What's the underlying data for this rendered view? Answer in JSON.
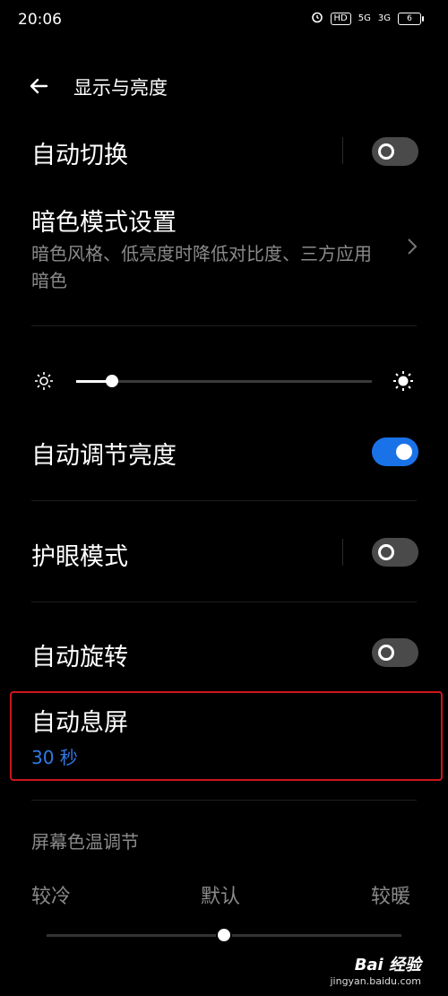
{
  "status_bar": {
    "time": "20:06",
    "hd_label": "HD",
    "signal1": "5G",
    "signal2": "3G",
    "battery": "6"
  },
  "header": {
    "back_icon": "arrow-left-icon",
    "title": "显示与亮度"
  },
  "items": {
    "auto_switch": {
      "label": "自动切换",
      "toggle_on": false
    },
    "dark_mode": {
      "label": "暗色模式设置",
      "description": "暗色风格、低亮度时降低对比度、三方应用暗色"
    },
    "brightness": {
      "level": 0.12
    },
    "auto_brightness": {
      "label": "自动调节亮度",
      "toggle_on": true
    },
    "eye_care": {
      "label": "护眼模式",
      "toggle_on": false
    },
    "auto_rotate": {
      "label": "自动旋转",
      "toggle_on": false
    },
    "auto_sleep": {
      "label": "自动息屏",
      "value": "30 秒"
    }
  },
  "color_temp": {
    "section_title": "屏幕色温调节",
    "cold_label": "较冷",
    "default_label": "默认",
    "warm_label": "较暖",
    "level": 0.5
  },
  "watermark": {
    "logo_text": "Bai 经验",
    "url": "jingyan.baidu.com"
  },
  "colors": {
    "accent": "#1a72e8",
    "highlight": "#d0141c",
    "value_blue": "#2f7ae5"
  }
}
